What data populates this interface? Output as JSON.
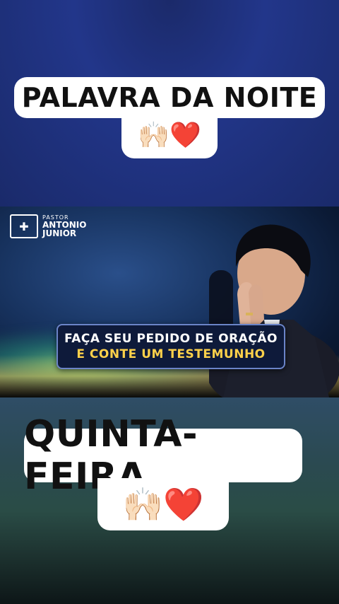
{
  "top_title": "PALAVRA DA NOITE",
  "top_emojis": [
    "🙌🏻",
    "❤️"
  ],
  "banner": {
    "logo_line1": "PASTOR",
    "logo_line2": "ANTONIO",
    "logo_line3": "JUNIOR",
    "cta_line1": "FAÇA SEU PEDIDO DE ORAÇÃO",
    "cta_line2": "E CONTE UM TESTEMUNHO"
  },
  "bottom_title": "QUINTA-FEIRA",
  "bottom_emojis": [
    "🙌🏻",
    "❤️"
  ],
  "colors": {
    "cta_highlight": "#ffd14a",
    "heart": "#d8202b"
  },
  "icons": [
    "praying-hands-icon",
    "heart-icon",
    "logo-icon"
  ]
}
